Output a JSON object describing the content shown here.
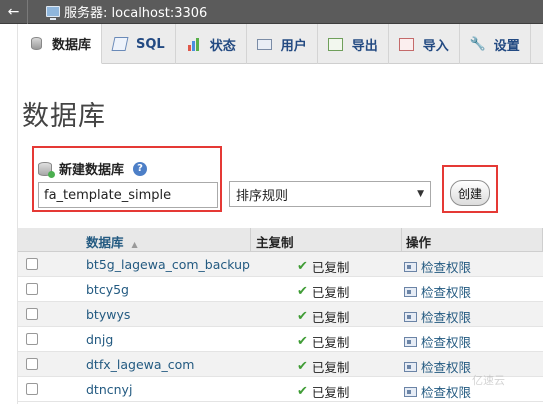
{
  "topbar": {
    "back": "←",
    "server_label": "服务器: localhost:3306"
  },
  "tabs": [
    {
      "label": "数据库",
      "icon": "database-icon",
      "active": true
    },
    {
      "label": "SQL",
      "icon": "sql-icon",
      "active": false
    },
    {
      "label": "状态",
      "icon": "status-icon",
      "active": false
    },
    {
      "label": "用户",
      "icon": "users-icon",
      "active": false
    },
    {
      "label": "导出",
      "icon": "export-icon",
      "active": false
    },
    {
      "label": "导入",
      "icon": "import-icon",
      "active": false
    },
    {
      "label": "设置",
      "icon": "settings-icon",
      "active": false
    }
  ],
  "page": {
    "title": "数据库"
  },
  "create": {
    "label": "新建数据库",
    "help": "?",
    "name_value": "fa_template_simple",
    "collation_value": "排序规则",
    "button_label": "创建"
  },
  "table": {
    "headers": {
      "name": "数据库",
      "replication": "主复制",
      "action": "操作"
    },
    "rows": [
      {
        "name": "bt5g_lagewa_com_backup",
        "replication": "已复制",
        "action": "检查权限"
      },
      {
        "name": "btcy5g",
        "replication": "已复制",
        "action": "检查权限"
      },
      {
        "name": "btywys",
        "replication": "已复制",
        "action": "检查权限"
      },
      {
        "name": "dnjg",
        "replication": "已复制",
        "action": "检查权限"
      },
      {
        "name": "dtfx_lagewa_com",
        "replication": "已复制",
        "action": "检查权限"
      },
      {
        "name": "dtncnyj",
        "replication": "已复制",
        "action": "检查权限"
      }
    ]
  },
  "watermark": "亿速云",
  "colors": {
    "highlight": "#e53935",
    "link": "#235a81",
    "check": "#3f9c35"
  }
}
